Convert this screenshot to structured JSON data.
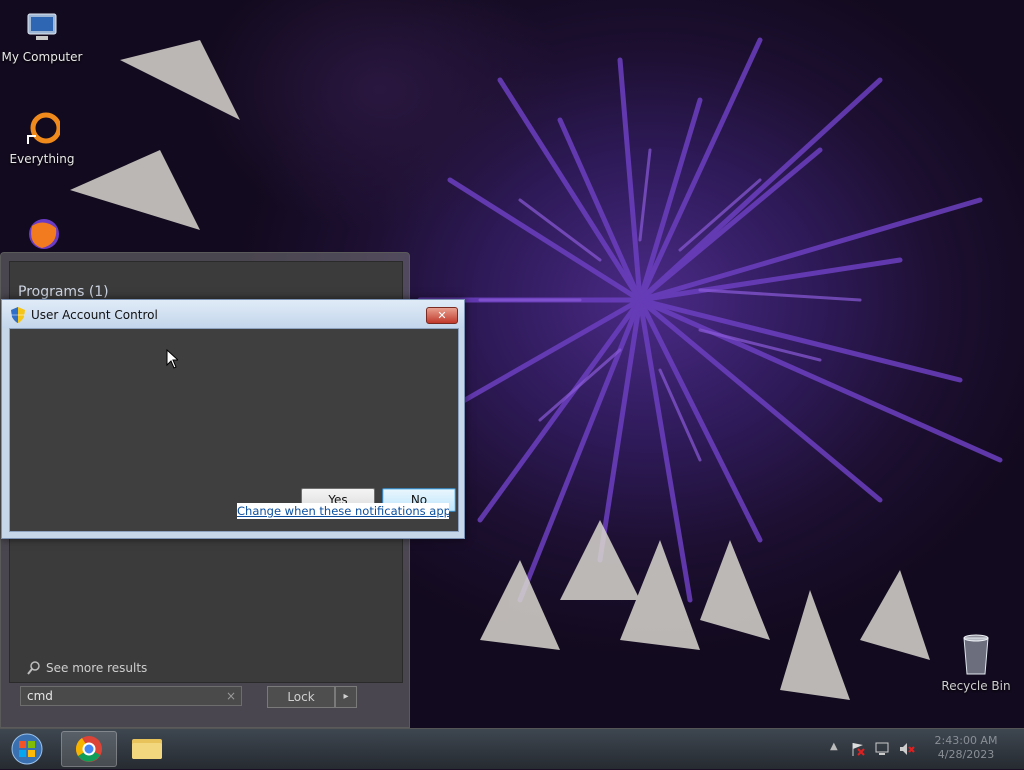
{
  "desktop": {
    "icons": [
      {
        "label": "My Computer"
      },
      {
        "label": "Everything"
      },
      {
        "label": ""
      }
    ],
    "recycle_bin": "Recycle Bin"
  },
  "start_menu": {
    "programs_header": "Programs (1)",
    "see_more": "See more results",
    "search_value": "cmd",
    "lock_label": "Lock",
    "clear_glyph": "×",
    "arrow_glyph": "▸"
  },
  "uac": {
    "title": "User Account Control",
    "close_glyph": "✕",
    "yes_label": "Yes",
    "no_label": "No",
    "link_text": "Change when these notifications appear"
  },
  "taskbar": {
    "time": "2:43:00 AM",
    "date": "4/28/2023"
  },
  "colors": {
    "wallpaper_purple": "#4a2a86",
    "uac_frame": "#c7d7ea",
    "link_blue": "#0b4f9e"
  }
}
